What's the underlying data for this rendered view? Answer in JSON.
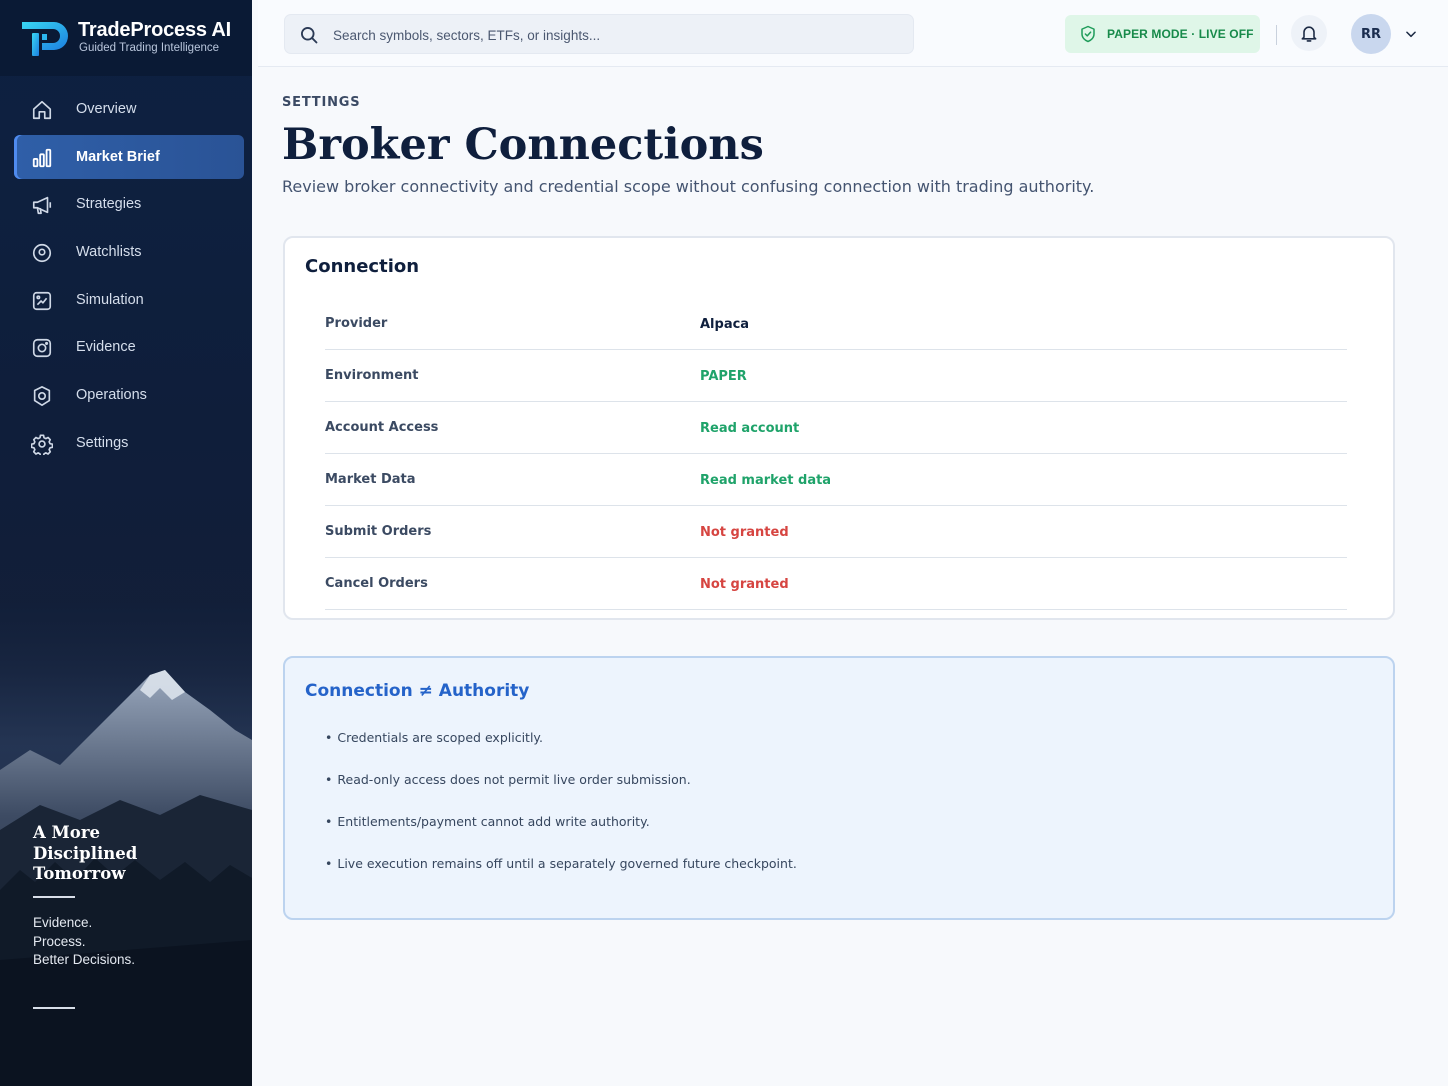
{
  "brand": {
    "name": "TradeProcess AI",
    "tagline": "Guided Trading Intelligence"
  },
  "sidebar": {
    "items": [
      {
        "label": "Overview",
        "icon": "home-icon",
        "active": false
      },
      {
        "label": "Market Brief",
        "icon": "bar-chart-icon",
        "active": true
      },
      {
        "label": "Strategies",
        "icon": "megaphone-icon",
        "active": false
      },
      {
        "label": "Watchlists",
        "icon": "map-pin-icon",
        "active": false
      },
      {
        "label": "Simulation",
        "icon": "chart-square-icon",
        "active": false
      },
      {
        "label": "Evidence",
        "icon": "camera-icon",
        "active": false
      },
      {
        "label": "Operations",
        "icon": "shield-icon",
        "active": false
      },
      {
        "label": "Settings",
        "icon": "gear-icon",
        "active": false
      }
    ],
    "promo": {
      "title_lines": [
        "A More",
        "Disciplined",
        "Tomorrow"
      ],
      "lines": [
        "Evidence.",
        "Process.",
        "Better Decisions."
      ]
    }
  },
  "topbar": {
    "search_placeholder": "Search symbols, sectors, ETFs, or insights...",
    "mode_badge": "PAPER MODE · LIVE OFF",
    "avatar_initials": "RR"
  },
  "page": {
    "breadcrumb": "SETTINGS",
    "title": "Broker Connections",
    "subtitle": "Review broker connectivity and credential scope without confusing connection with trading authority."
  },
  "connection": {
    "title": "Connection",
    "rows": [
      {
        "key": "Provider",
        "value": "Alpaca",
        "status": "neutral"
      },
      {
        "key": "Environment",
        "value": "PAPER",
        "status": "ok"
      },
      {
        "key": "Account Access",
        "value": "Read account",
        "status": "ok"
      },
      {
        "key": "Market Data",
        "value": "Read market data",
        "status": "ok"
      },
      {
        "key": "Submit Orders",
        "value": "Not granted",
        "status": "denied"
      },
      {
        "key": "Cancel Orders",
        "value": "Not granted",
        "status": "denied"
      }
    ]
  },
  "authority_note": {
    "title": "Connection ≠ Authority",
    "points": [
      "Credentials are scoped explicitly.",
      "Read-only access does not permit live order submission.",
      "Entitlements/payment cannot add write authority.",
      "Live execution remains off until a separately governed future checkpoint."
    ]
  },
  "colors": {
    "accent": "#2563c9",
    "ok": "#1fa36a",
    "denied": "#d64541",
    "neutral": "#0f1f3d",
    "sidebar": "#0d2142"
  }
}
